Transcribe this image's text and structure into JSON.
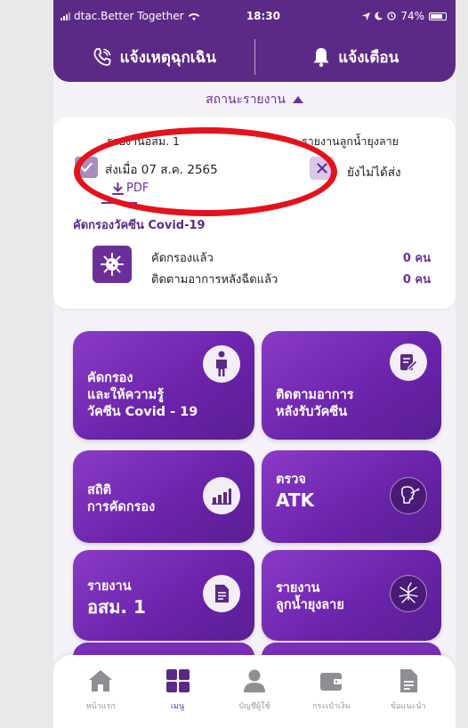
{
  "status_bar": {
    "carrier": "dtac.Better Together",
    "time": "18:30",
    "battery": "74%"
  },
  "top_buttons": {
    "emergency": "แจ้งเหตุฉุกเฉิน",
    "notify": "แจ้งเตือน"
  },
  "report_status": {
    "toggle_label": "สถานะรายงาน",
    "osm1": {
      "title": "รายงานอสม. 1",
      "status": "ส่งเมื่อ 07 ส.ค. 2565",
      "pdf": "PDF"
    },
    "larva": {
      "title": "รายงานลูกน้ำยุงลาย",
      "status": "ยังไม่ได้ส่ง"
    }
  },
  "covid_screening": {
    "title": "คัดกรองวัคซีน Covid-19",
    "rows": [
      {
        "label": "คัดกรองแล้ว",
        "value": "0 คน"
      },
      {
        "label": "ติดตามอาการหลังฉีดแล้ว",
        "value": "0 คน"
      }
    ]
  },
  "menu_tiles": [
    {
      "line1": "คัดกรอง",
      "line2": "และให้ความรู้",
      "line3": "วัคซีน Covid - 19",
      "icon": "person-icon"
    },
    {
      "line1": "ติดตามอาการ",
      "line2": "หลังรับวัคซีน",
      "icon": "edit-note-icon"
    },
    {
      "line1": "สถิติ",
      "line2": "การคัดกรอง",
      "icon": "bar-chart-icon"
    },
    {
      "line1": "ตรวจ",
      "line2": "ATK",
      "icon": "nose-swab-icon"
    },
    {
      "line1": "รายงาน",
      "line2": "อสม. 1",
      "icon": "document-icon"
    },
    {
      "line1": "รายงาน",
      "line2": "ลูกน้ำยุงลาย",
      "icon": "mosquito-icon"
    }
  ],
  "bottom_nav": [
    {
      "label": "หน้าแรก",
      "icon": "home-icon"
    },
    {
      "label": "เมนู",
      "icon": "grid-icon",
      "active": true
    },
    {
      "label": "บัญชีผู้ใช้",
      "icon": "user-icon"
    },
    {
      "label": "กระเป๋าเงิน",
      "icon": "wallet-icon"
    },
    {
      "label": "ข้อแนะนำ",
      "icon": "file-icon"
    }
  ],
  "colors": {
    "primary": "#5b2a86",
    "accent": "#6b2f9a",
    "highlight": "#e3121b"
  }
}
